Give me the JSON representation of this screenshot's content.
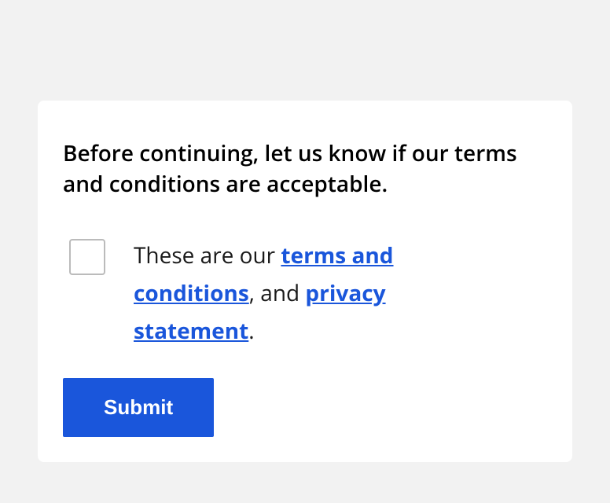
{
  "form": {
    "legend": "Before continuing, let us know if our terms and conditions are acceptable.",
    "consent": {
      "pre": "These are our ",
      "terms_link": "terms and conditions",
      "mid": ", and ",
      "privacy_link": "privacy statement",
      "post": "."
    },
    "submit_label": "Submit"
  }
}
